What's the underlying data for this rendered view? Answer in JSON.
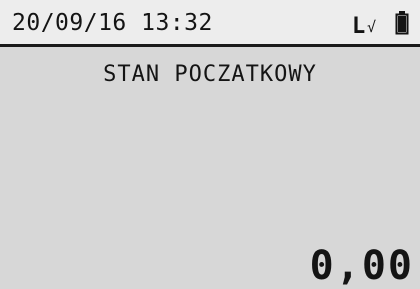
{
  "status": {
    "datetime": "20/09/16 13:32",
    "signal_label": "L",
    "check_mark": "√",
    "battery_icon": "battery-icon"
  },
  "screen": {
    "title": "STAN POCZATKOWY",
    "amount": "0,00"
  },
  "colors": {
    "screen_bg": "#d7d7d7",
    "status_bg": "#ededed",
    "text": "#141414"
  }
}
